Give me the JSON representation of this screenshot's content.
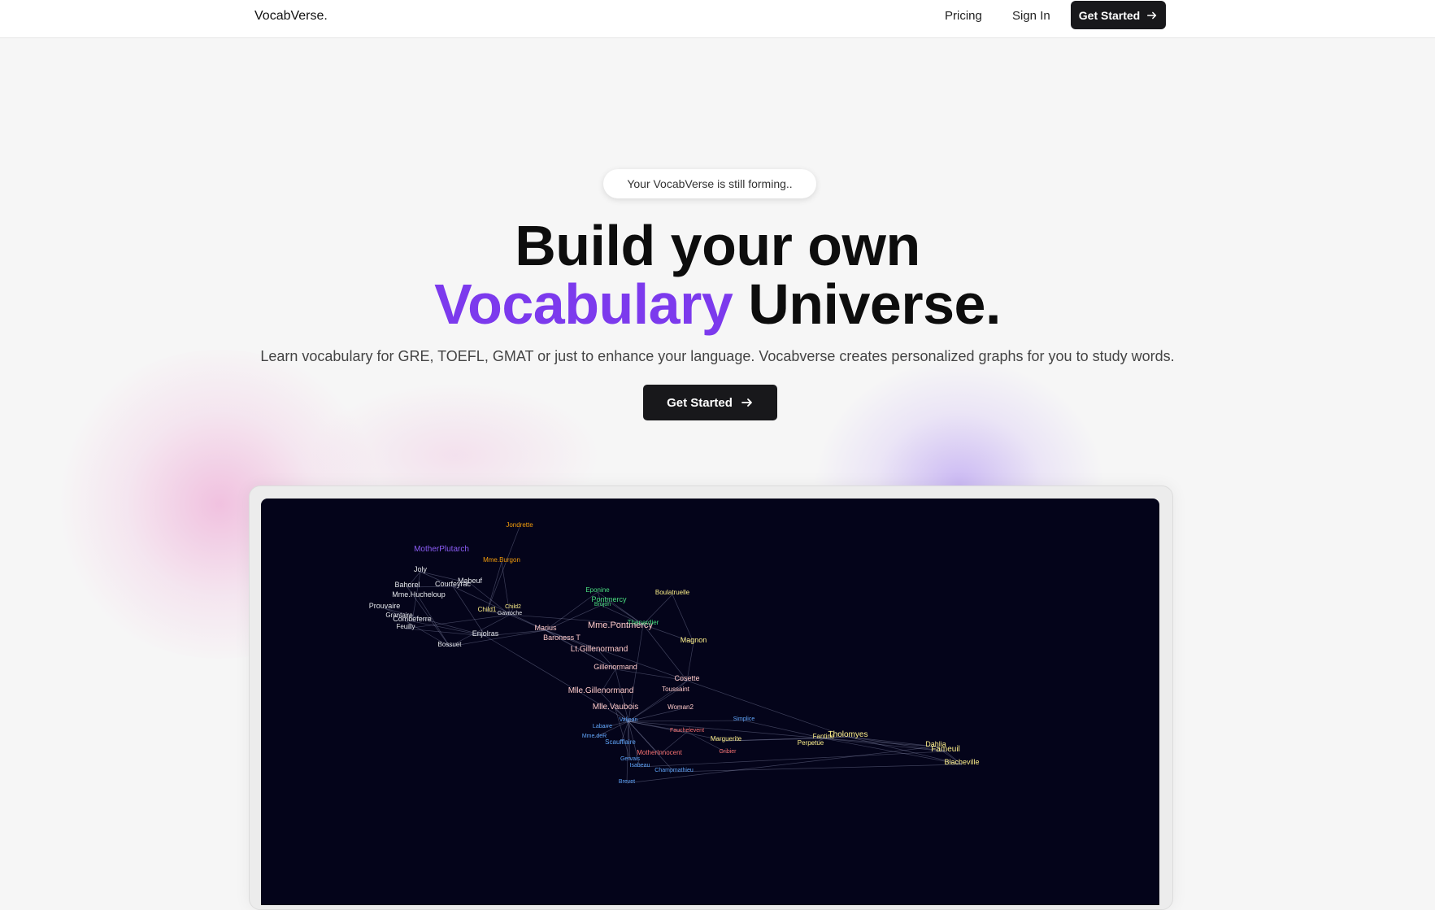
{
  "nav": {
    "logo": "VocabVerse.",
    "links": [
      "Pricing",
      "Sign In"
    ],
    "cta_label": "Get Started"
  },
  "hero": {
    "badge": "Your VocabVerse is still forming..",
    "title_line1": "Build your own",
    "title_accent": "Vocabulary",
    "title_line2_rest": "Universe.",
    "subtitle": "Learn vocabulary for GRE, TOEFL, GMAT or just to enhance your language. Vocabverse creates personalized graphs for you to study words.",
    "cta_label": "Get Started"
  },
  "colors": {
    "accent": "#7c3aed",
    "button_bg": "#18181b",
    "graph_bg": "#04041a"
  },
  "graph": {
    "nodes": [
      {
        "label": "Jondrette",
        "color": "#f59e0b",
        "size": 8
      },
      {
        "label": "MotherPlutarch",
        "color": "#8b5cf6",
        "size": 10
      },
      {
        "label": "Mme.Burgon",
        "color": "#f59e0b",
        "size": 8
      },
      {
        "label": "Joly",
        "color": "#e5e7eb",
        "size": 9
      },
      {
        "label": "Bahorel",
        "color": "#e5e7eb",
        "size": 9
      },
      {
        "label": "Courfeyrac",
        "color": "#e5e7eb",
        "size": 9
      },
      {
        "label": "Mabeuf",
        "color": "#e5e7eb",
        "size": 9
      },
      {
        "label": "Mme.Hucheloup",
        "color": "#e5e7eb",
        "size": 9
      },
      {
        "label": "Prouvaire",
        "color": "#e5e7eb",
        "size": 9
      },
      {
        "label": "Grantaire",
        "color": "#e5e7eb",
        "size": 8
      },
      {
        "label": "Combeferre",
        "color": "#e5e7eb",
        "size": 9
      },
      {
        "label": "Feuilly",
        "color": "#e5e7eb",
        "size": 8
      },
      {
        "label": "Bossuet",
        "color": "#e5e7eb",
        "size": 8
      },
      {
        "label": "Child1",
        "color": "#fef08a",
        "size": 8
      },
      {
        "label": "Child2",
        "color": "#fef08a",
        "size": 7
      },
      {
        "label": "Gavroche",
        "color": "#e5e7eb",
        "size": 7
      },
      {
        "label": "Enjolras",
        "color": "#e5e7eb",
        "size": 9
      },
      {
        "label": "Marius",
        "color": "#fecaca",
        "size": 9
      },
      {
        "label": "Eponine",
        "color": "#4ade80",
        "size": 8
      },
      {
        "label": "Pontmercy",
        "color": "#4ade80",
        "size": 9
      },
      {
        "label": "Brujon",
        "color": "#4ade80",
        "size": 7
      },
      {
        "label": "Boulatruelle",
        "color": "#fef08a",
        "size": 8
      },
      {
        "label": "Mme.Pontmercy",
        "color": "#fecaca",
        "size": 11
      },
      {
        "label": "Thenardier",
        "color": "#4ade80",
        "size": 8
      },
      {
        "label": "Baroness T",
        "color": "#fecaca",
        "size": 9
      },
      {
        "label": "Magnon",
        "color": "#fef08a",
        "size": 9
      },
      {
        "label": "Lt.Gillenormand",
        "color": "#fecaca",
        "size": 10
      },
      {
        "label": "Gillenormand",
        "color": "#fecaca",
        "size": 9
      },
      {
        "label": "Cosette",
        "color": "#fecaca",
        "size": 9
      },
      {
        "label": "Toussaint",
        "color": "#fecaca",
        "size": 8
      },
      {
        "label": "Mlle.Gillenormand",
        "color": "#fecaca",
        "size": 10
      },
      {
        "label": "Mlle.Vaubois",
        "color": "#fecaca",
        "size": 10
      },
      {
        "label": "Woman2",
        "color": "#fecaca",
        "size": 8
      },
      {
        "label": "Valjean",
        "color": "#60a5fa",
        "size": 7
      },
      {
        "label": "Labarre",
        "color": "#60a5fa",
        "size": 7
      },
      {
        "label": "Mme.deR",
        "color": "#60a5fa",
        "size": 7
      },
      {
        "label": "Scaufflaire",
        "color": "#60a5fa",
        "size": 8
      },
      {
        "label": "Fauchelevent",
        "color": "#f87171",
        "size": 7
      },
      {
        "label": "MotherInnocent",
        "color": "#f87171",
        "size": 8
      },
      {
        "label": "Gribier",
        "color": "#f87171",
        "size": 7
      },
      {
        "label": "Marguerite",
        "color": "#fef08a",
        "size": 8
      },
      {
        "label": "Simplice",
        "color": "#60a5fa",
        "size": 7
      },
      {
        "label": "Gervais",
        "color": "#60a5fa",
        "size": 7
      },
      {
        "label": "Isabeau",
        "color": "#60a5fa",
        "size": 7
      },
      {
        "label": "Champmathieu",
        "color": "#60a5fa",
        "size": 7
      },
      {
        "label": "Fantine",
        "color": "#fef08a",
        "size": 8
      },
      {
        "label": "Perpetue",
        "color": "#fef08a",
        "size": 8
      },
      {
        "label": "Tholomyes",
        "color": "#fef08a",
        "size": 10
      },
      {
        "label": "Dahlia",
        "color": "#fef08a",
        "size": 9
      },
      {
        "label": "Fameuil",
        "color": "#fef08a",
        "size": 10
      },
      {
        "label": "Blacheville",
        "color": "#fef08a",
        "size": 9
      },
      {
        "label": "Brevet",
        "color": "#60a5fa",
        "size": 7
      }
    ]
  }
}
